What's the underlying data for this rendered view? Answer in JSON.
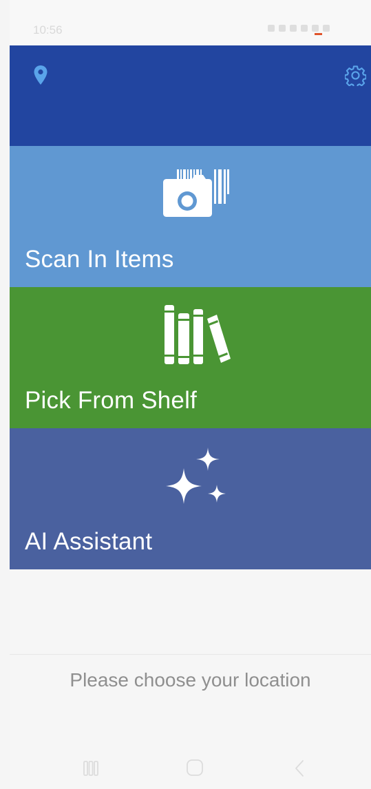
{
  "status_bar": {
    "time": "10:56"
  },
  "header": {
    "location_icon": "location-pin-icon",
    "settings_icon": "gear-icon"
  },
  "tiles": [
    {
      "label": "Scan In Items",
      "icon": "camera-barcode-icon",
      "color": "#6098d2"
    },
    {
      "label": "Pick From Shelf",
      "icon": "books-shelf-icon",
      "color": "#4a9534"
    },
    {
      "label": "AI Assistant",
      "icon": "sparkles-icon",
      "color": "#4a619f"
    }
  ],
  "header_color": "#2245a0",
  "location_prompt": "Please choose your location",
  "nav": {
    "recent_icon": "recent-apps-icon",
    "home_icon": "home-icon",
    "back_icon": "back-icon"
  }
}
